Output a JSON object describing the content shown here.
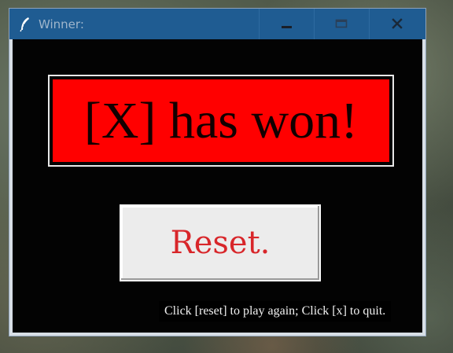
{
  "window": {
    "title": "Winner:",
    "controls": {
      "minimize": "minimize-icon",
      "maximize": "maximize-icon",
      "close": "close-icon"
    },
    "titlebar_color": "#1f5c92"
  },
  "main": {
    "winner_message": "[X] has won!",
    "reset_label": "Reset.",
    "hint": "Click [reset] to play again; Click [x] to quit.",
    "banner_color": "#ff0000",
    "reset_text_color": "#d8262a",
    "background_color": "#030303"
  }
}
